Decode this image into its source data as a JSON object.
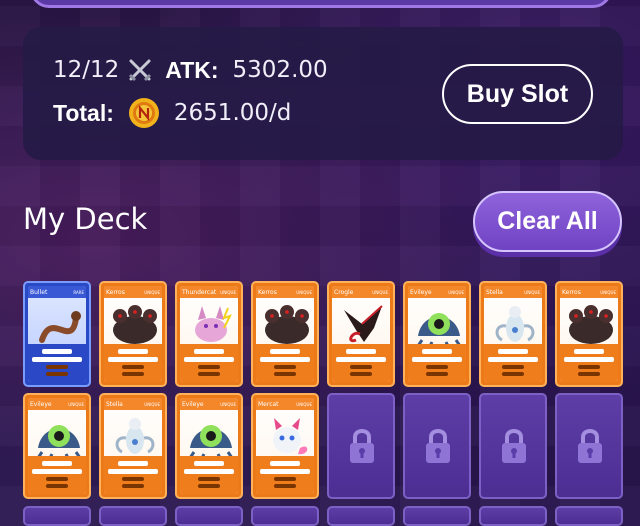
{
  "stats": {
    "slots": "12/12",
    "atk_label": "ATK:",
    "atk_value": "5302.00",
    "total_label": "Total:",
    "total_value": "2651.00/d"
  },
  "buttons": {
    "buy_slot": "Buy Slot",
    "clear_all": "Clear All"
  },
  "deck": {
    "title": "My Deck",
    "cards": [
      {
        "name": "Bullet",
        "rarity": "RARE",
        "color": "blue",
        "art": "snake"
      },
      {
        "name": "Kerros",
        "rarity": "UNIQUE",
        "color": "orange",
        "art": "hound"
      },
      {
        "name": "Thundercat",
        "rarity": "UNIQUE",
        "color": "orange",
        "art": "cat"
      },
      {
        "name": "Kerros",
        "rarity": "UNIQUE",
        "color": "orange",
        "art": "hound"
      },
      {
        "name": "Crogle",
        "rarity": "UNIQUE",
        "color": "orange",
        "art": "dragon"
      },
      {
        "name": "Evileye",
        "rarity": "UNIQUE",
        "color": "orange",
        "art": "eye"
      },
      {
        "name": "Stella",
        "rarity": "UNIQUE",
        "color": "orange",
        "art": "spirit"
      },
      {
        "name": "Kerros",
        "rarity": "UNIQUE",
        "color": "orange",
        "art": "hound"
      },
      {
        "name": "Evileye",
        "rarity": "UNIQUE",
        "color": "orange",
        "art": "eye"
      },
      {
        "name": "Stella",
        "rarity": "UNIQUE",
        "color": "orange",
        "art": "spirit"
      },
      {
        "name": "Evileye",
        "rarity": "UNIQUE",
        "color": "orange",
        "art": "eye"
      },
      {
        "name": "Mercat",
        "rarity": "UNIQUE",
        "color": "orange",
        "art": "fox"
      }
    ],
    "locked_slots": 4,
    "colors": {
      "orange": "#ec7a19",
      "blue": "#2a49c4",
      "locked": "#5c3ea6"
    }
  },
  "icons": [
    "swords-icon",
    "coin-icon",
    "lock-icon"
  ]
}
